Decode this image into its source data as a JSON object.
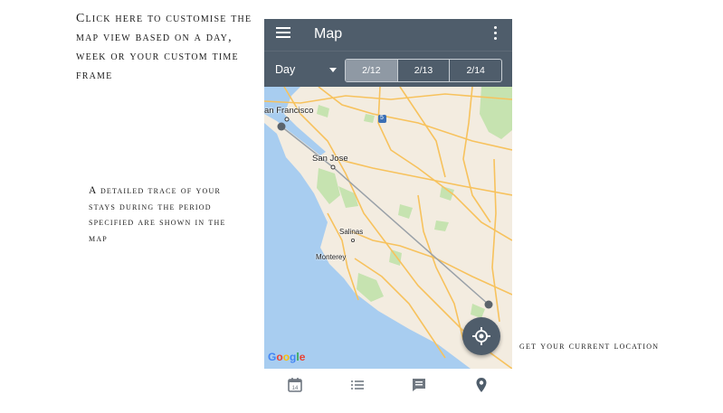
{
  "annotations": {
    "top": "Click here to customise the map view based on a day, week or your custom time frame",
    "middle": "A detailed trace of your stays during the period specified are shown in the map",
    "bottom": "get your current location"
  },
  "app_bar": {
    "title": "Map",
    "menu_icon": "hamburger-menu-icon",
    "overflow_icon": "more-vert-icon"
  },
  "filter_bar": {
    "period_selected": "Day",
    "period_icon": "dropdown-caret-icon",
    "date_tabs": [
      {
        "label": "2/12",
        "active": true
      },
      {
        "label": "2/13",
        "active": false
      },
      {
        "label": "2/14",
        "active": false
      }
    ]
  },
  "map": {
    "labels": {
      "san_francisco": "an Francisco",
      "san_jose": "San Jose",
      "salinas": "Salinas",
      "monterey": "Monterey",
      "highway": "5"
    },
    "attribution": {
      "g1": "G",
      "o1": "o",
      "o2": "o",
      "g2": "g",
      "l": "l",
      "e": "e"
    }
  },
  "fab": {
    "icon": "my-location-icon"
  },
  "bottom_nav": [
    {
      "icon": "calendar-icon",
      "label": "14",
      "active": false
    },
    {
      "icon": "list-icon",
      "active": false
    },
    {
      "icon": "chat-icon",
      "active": false
    },
    {
      "icon": "map-pin-icon",
      "active": true
    }
  ],
  "colors": {
    "app_bar": "#4f5d6b",
    "water": "#a8cdf0",
    "land": "#f3ece0",
    "park": "#c6e3b0",
    "road": "#f7c25d",
    "trace": "#5b636b"
  }
}
